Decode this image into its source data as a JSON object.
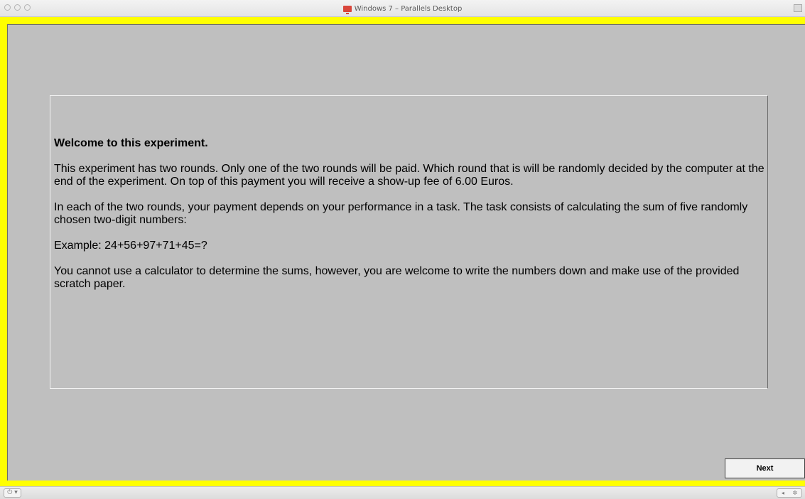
{
  "window": {
    "title": "Windows 7 – Parallels Desktop"
  },
  "screen": {
    "heading": "Welcome to this experiment.",
    "paragraphs": [
      "This experiment has two rounds. Only one of the two rounds will be paid. Which round that is will be randomly decided by the computer at the end of the experiment. On top of this payment you will receive a show-up fee of 6.00 Euros.",
      "In each of the two rounds, your payment depends on your performance in a task. The task consists of calculating the sum of five randomly chosen two-digit numbers:",
      "Example: 24+56+97+71+45=?",
      "You cannot use a calculator to determine the sums, however, you are welcome to write the numbers down and make use of the provided scratch paper."
    ],
    "next_label": "Next"
  },
  "statusbar": {
    "power_glyph": "⏻ ▾",
    "right_glyphs": [
      "◂",
      "✲"
    ]
  },
  "colors": {
    "frame_border": "#ffff00",
    "screen_background": "#bfbfbf",
    "title_icon": "#d9463b"
  }
}
